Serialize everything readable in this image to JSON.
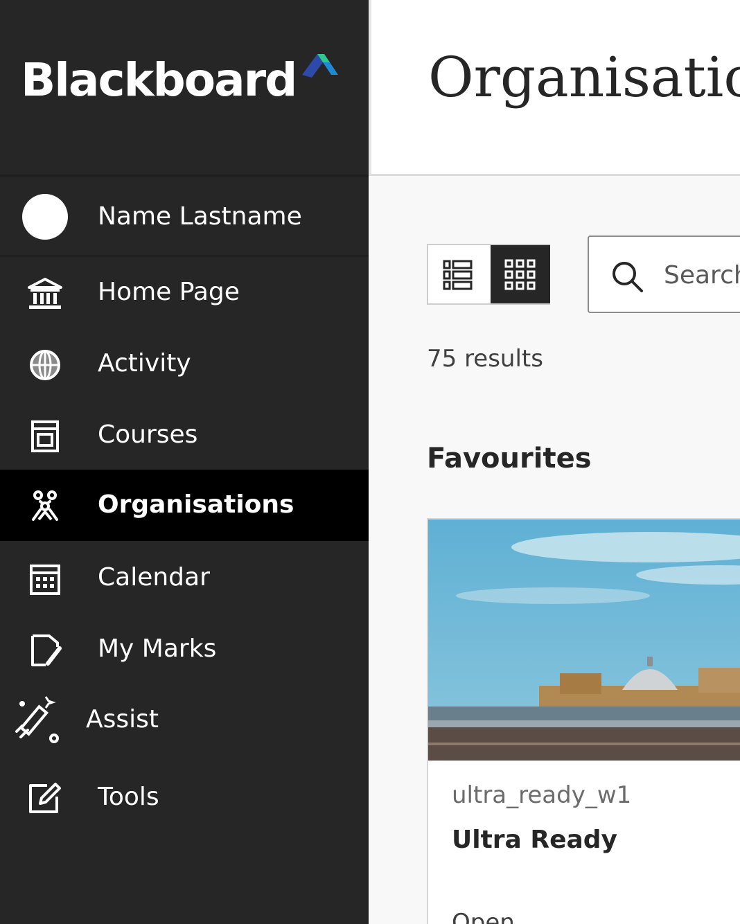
{
  "brand": {
    "logo_text": "Blackboard",
    "logo_colors": [
      "#1e8ad6",
      "#2fc78c",
      "#2d4aa8"
    ]
  },
  "user": {
    "name": "Name Lastname"
  },
  "sidebar": {
    "items": [
      {
        "label": "Home Page",
        "icon": "institution-icon",
        "active": false
      },
      {
        "label": "Activity",
        "icon": "globe-icon",
        "active": false
      },
      {
        "label": "Courses",
        "icon": "courses-icon",
        "active": false
      },
      {
        "label": "Organisations",
        "icon": "organisations-icon",
        "active": true
      },
      {
        "label": "Calendar",
        "icon": "calendar-icon",
        "active": false
      },
      {
        "label": "My Marks",
        "icon": "marks-icon",
        "active": false
      },
      {
        "label": "Assist",
        "icon": "assist-icon",
        "active": false
      },
      {
        "label": "Tools",
        "icon": "tools-icon",
        "active": false
      }
    ]
  },
  "main": {
    "title": "Organisations",
    "view_toggle": {
      "options": [
        "list-view-icon",
        "grid-view-icon"
      ],
      "selected": "grid-view-icon"
    },
    "search": {
      "placeholder": "Search",
      "value": ""
    },
    "results_count": "75 results",
    "sections": [
      {
        "heading": "Favourites",
        "cards": [
          {
            "id": "ultra_ready_w1",
            "title": "Ultra Ready",
            "status": "Open"
          }
        ]
      }
    ]
  },
  "colors": {
    "sidebar_bg": "#262626",
    "sidebar_active_bg": "#000000",
    "main_bg": "#f8f8f8"
  }
}
